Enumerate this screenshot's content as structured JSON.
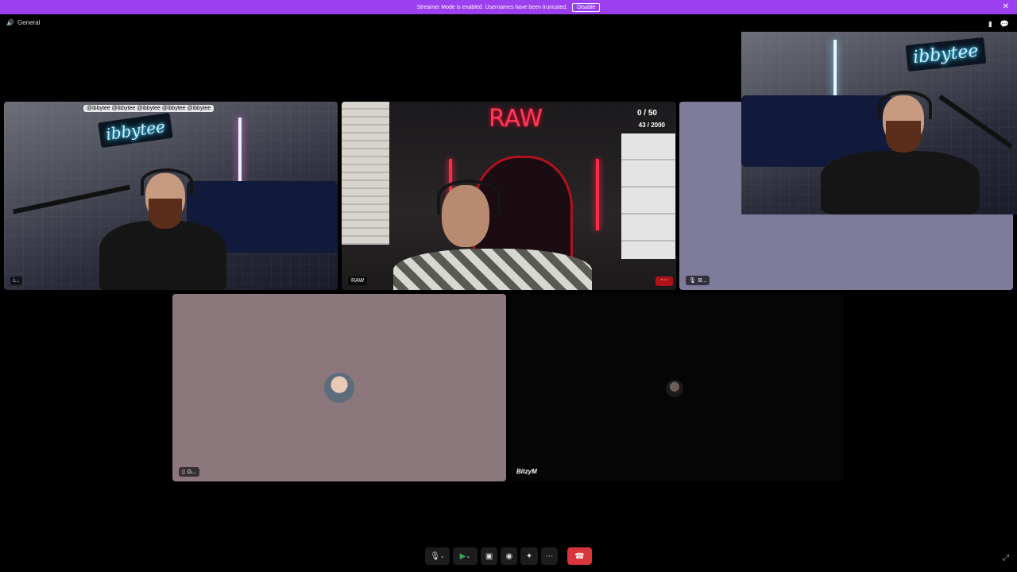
{
  "banner": {
    "text": "Streamer Mode is enabled. Usernames have been truncated.",
    "disable_label": "Disable"
  },
  "channel": {
    "name": "General"
  },
  "tiles": {
    "t1": {
      "label": "i...",
      "neon": "ibbytee",
      "overlay": "@ibbytee @ibbytee @ibbytee @ibbytee @ibbytee"
    },
    "t2": {
      "label": "RAW",
      "neon": "RAW",
      "counter_top": "0 / 50",
      "counter_bottom": "43 / 2000"
    },
    "t3": {
      "label": "B..."
    },
    "t4": {
      "neon": "ibbytee"
    },
    "t5": {
      "label": "G..."
    },
    "t6": {
      "label": "BitzyM"
    }
  },
  "icons": {
    "speaker": "speaker-icon",
    "close": "close-icon",
    "pin": "bookmark-icon",
    "chat": "chat-icon",
    "mic": "microphone-icon",
    "camera": "camera-icon",
    "screen": "screen-share-icon",
    "activity": "gamepad-icon",
    "soundboard": "soundboard-icon",
    "more": "more-icon",
    "hangup": "hang-up-icon",
    "fullscreen": "fullscreen-icon"
  },
  "colors": {
    "banner": "#9b3ff0",
    "hangup": "#d8353c",
    "tile3_bg": "#7e7b9b",
    "tile5_bg": "#8b777c"
  }
}
